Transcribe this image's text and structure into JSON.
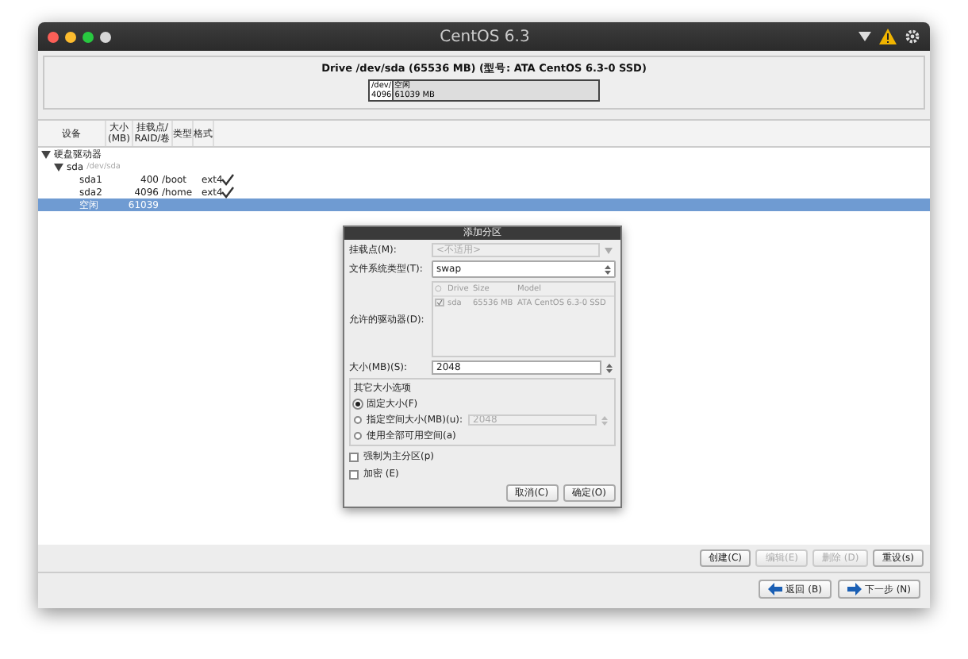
{
  "window": {
    "title": "CentOS 6.3"
  },
  "drive": {
    "title": "Drive /dev/sda (65536 MB) (型号: ATA CentOS 6.3-0 SSD)",
    "segments": [
      {
        "label": "/dev/",
        "size": "4096",
        "level": 0.08
      },
      {
        "label": "空闲",
        "size": "61039 MB",
        "level": 0.92
      }
    ]
  },
  "table": {
    "columns": [
      "设备",
      "大小\n(MB)",
      "挂载点/\nRAID/卷",
      "类型",
      "格式"
    ],
    "rows": [
      {
        "device": "硬盘驱动器",
        "selected": false,
        "expanded": true,
        "children": [
          {
            "device": "sda",
            "note": "/dev/sda",
            "selected": false,
            "expanded": true,
            "children": [
              {
                "device": "sda1",
                "size": "400",
                "mount": "/boot",
                "type": "ext4",
                "format": true,
                "selected": false
              },
              {
                "device": "sda2",
                "size": "4096",
                "mount": "/home",
                "type": "ext4",
                "format": true,
                "selected": false
              },
              {
                "device": "空闲",
                "size": "61039",
                "selected": true
              }
            ]
          }
        ]
      }
    ]
  },
  "dialog": {
    "title": "添加分区",
    "mount_label": "挂载点(M):",
    "mount_placeholder": "<不适用>",
    "fs_label": "文件系统类型(T):",
    "fs_value": "swap",
    "drives_label": "允许的驱动器(D):",
    "drive_columns": [
      "○",
      "Drive",
      "Size",
      "Model"
    ],
    "drives": [
      {
        "checked": true,
        "drive": "sda",
        "size": "65536 MB",
        "model": "ATA CentOS 6.3-0 SSD"
      }
    ],
    "size_label": "大小(MB)(S):",
    "size_value": "2048",
    "options_title": "其它大小选项",
    "options": [
      {
        "label": "固定大小(F)",
        "selected": true,
        "kind": "plain"
      },
      {
        "label": "指定空间大小(MB)(u):",
        "selected": false,
        "kind": "spin",
        "value": "2048"
      },
      {
        "label": "使用全部可用空间(a)",
        "selected": false,
        "kind": "plain"
      }
    ],
    "checks": [
      {
        "label": "强制为主分区(p)",
        "checked": false
      },
      {
        "label": "加密 (E)",
        "checked": false
      }
    ],
    "buttons": [
      "取消(C)",
      "确定(O)"
    ]
  },
  "actions": [
    {
      "label": "创建(C)",
      "disabled": false
    },
    {
      "label": "编辑(E)",
      "disabled": true
    },
    {
      "label": "删除 (D)",
      "disabled": true
    },
    {
      "label": "重设(s)",
      "disabled": false
    }
  ],
  "nav": [
    "返回 (B)",
    "下一步 (N)"
  ]
}
